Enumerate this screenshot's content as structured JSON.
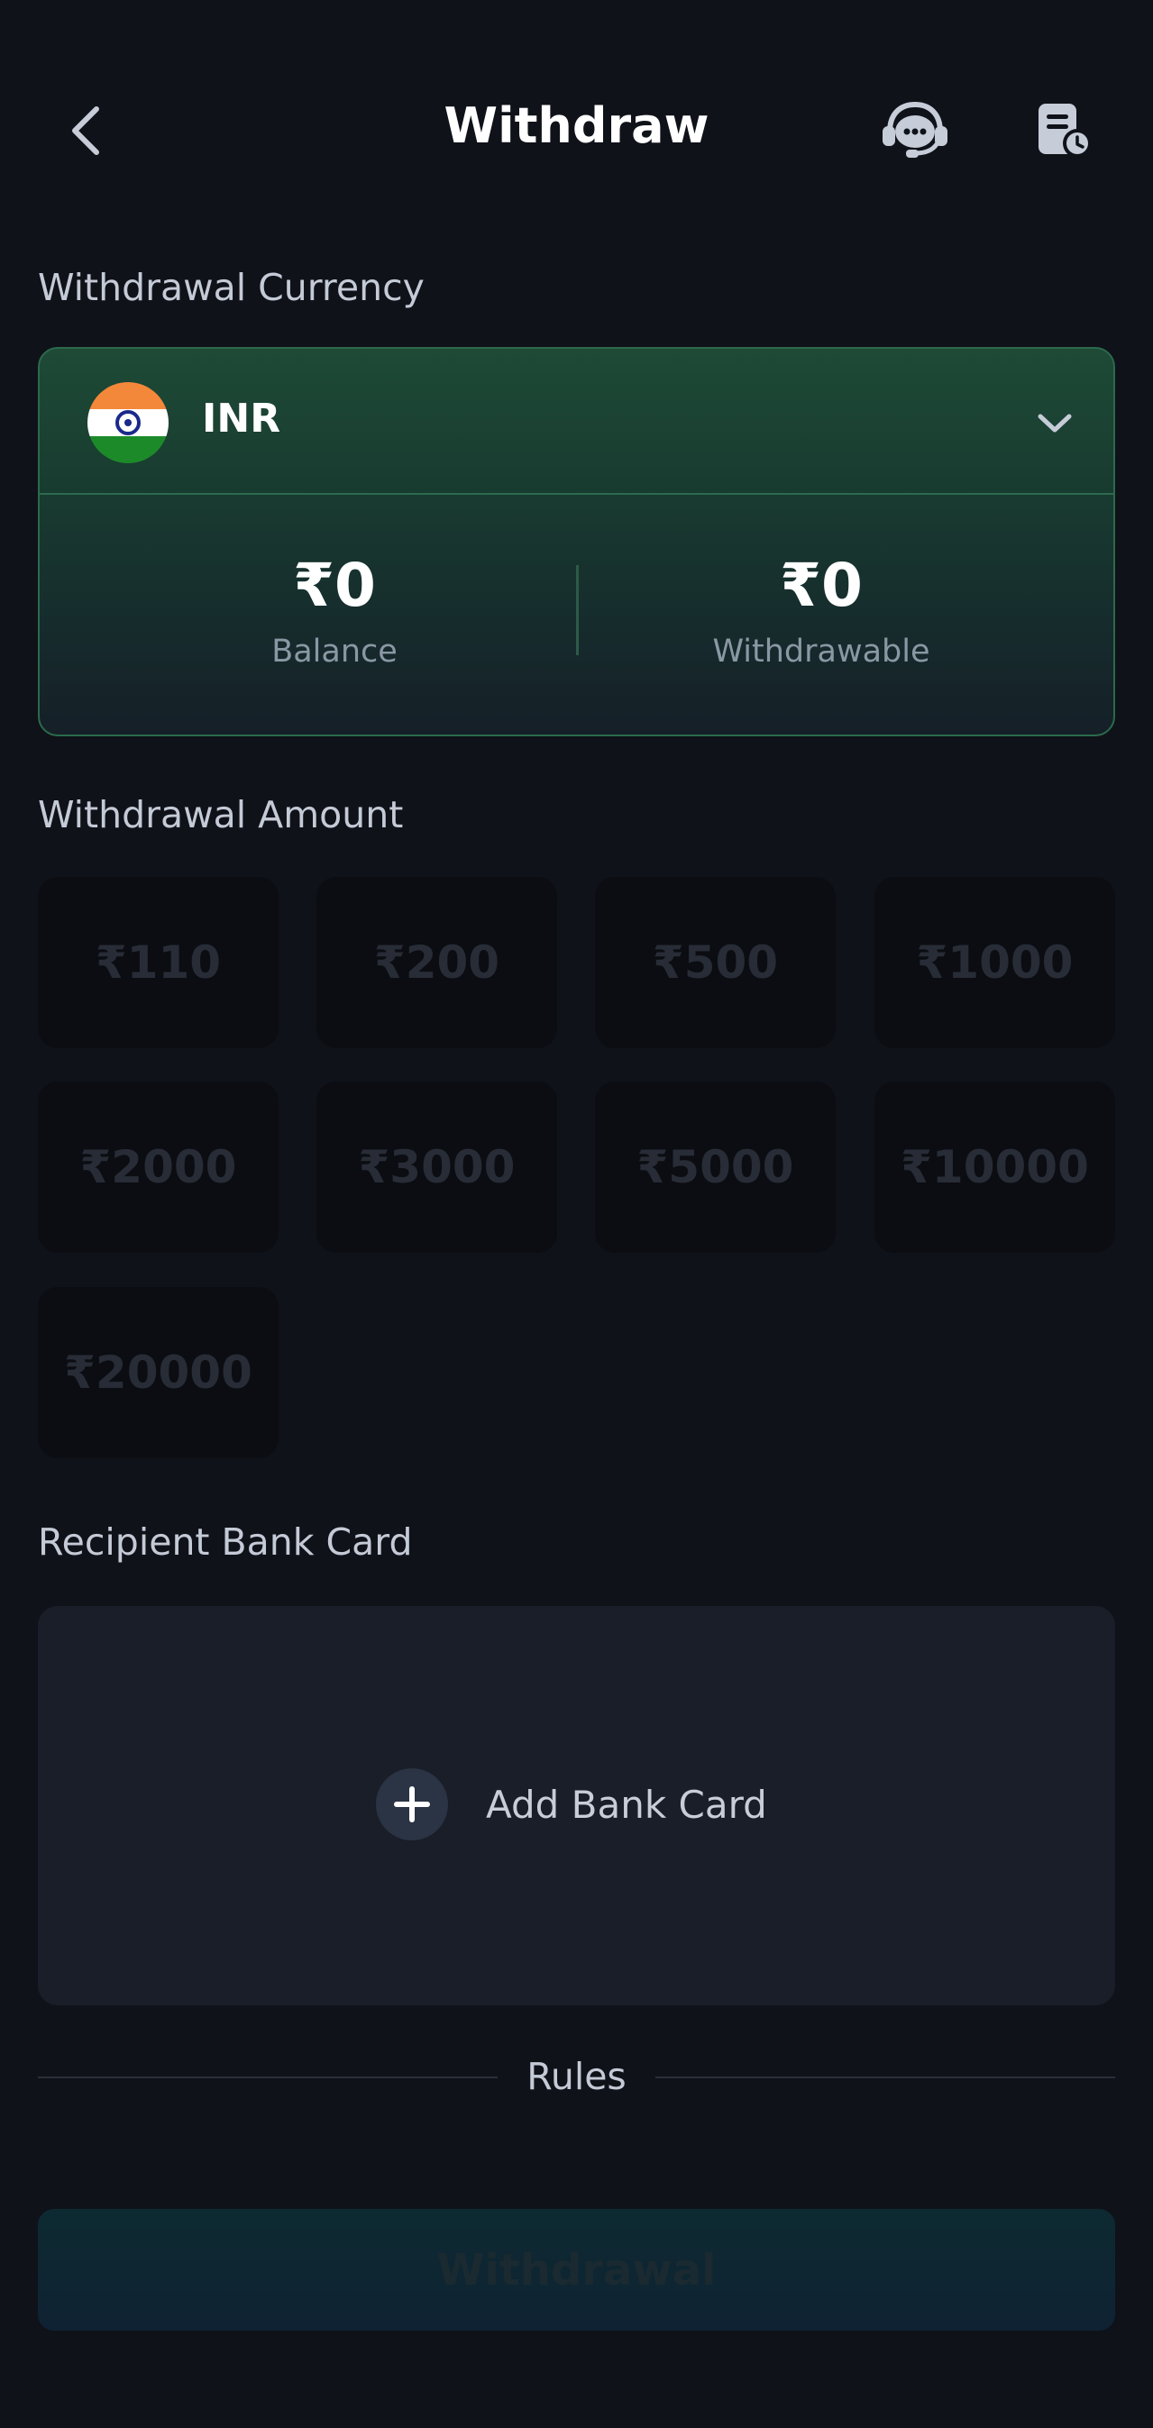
{
  "header": {
    "title": "Withdraw",
    "back_icon": "chevron-left-icon",
    "support_icon": "customer-support-icon",
    "history_icon": "records-history-icon"
  },
  "currency_section": {
    "label": "Withdrawal Currency",
    "selected": {
      "code": "INR",
      "flag": "india-flag-icon"
    },
    "balance": {
      "value": "₹0",
      "label": "Balance"
    },
    "withdrawable": {
      "value": "₹0",
      "label": "Withdrawable"
    }
  },
  "amount_section": {
    "label": "Withdrawal Amount",
    "options": [
      "₹110",
      "₹200",
      "₹500",
      "₹1000",
      "₹2000",
      "₹3000",
      "₹5000",
      "₹10000",
      "₹20000"
    ]
  },
  "bank_section": {
    "label": "Recipient Bank Card",
    "add_label": "Add Bank Card"
  },
  "rules": {
    "label": "Rules"
  },
  "submit": {
    "label": "Withdrawal"
  },
  "colors": {
    "background": "#0f1219",
    "card_border": "#2b6a4c",
    "card_top": "#1e4a36",
    "amount_bg": "#0b0d12",
    "bank_card_bg": "#1a1e29",
    "button_bg": "#0d2a32"
  }
}
